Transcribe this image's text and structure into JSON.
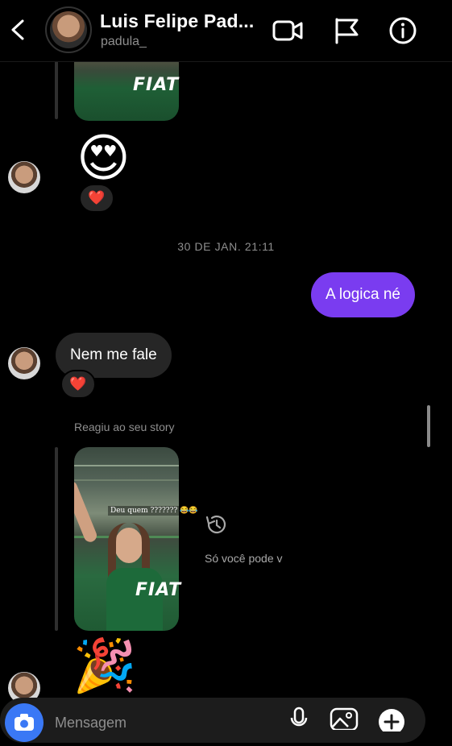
{
  "header": {
    "name": "Luis Felipe Pad...",
    "username": "padula_",
    "icons": [
      "back-icon",
      "video-call-icon",
      "flag-icon",
      "info-icon"
    ]
  },
  "thread": {
    "reaction_emoji": "❤️",
    "big_emoji_1": "😍",
    "timestamp": "30 DE JAN. 21:11",
    "sent_message": "A logica né",
    "received_message": "Nem me fale",
    "reacted_story_label": "Reagiu ao seu story",
    "story_caption": "Deu quem ??????? 😂😂",
    "story_jersey_text": "FIAT",
    "expired_story_text": "Só você pode v",
    "big_emoji_2": "🎉"
  },
  "composer": {
    "placeholder": "Mensagem",
    "icons": [
      "camera-icon",
      "microphone-icon",
      "gallery-icon",
      "plus-icon"
    ]
  },
  "colors": {
    "sent_bubble": "#7a3cf0",
    "received_bubble": "#262626",
    "camera_button": "#3a78f5",
    "heart": "#ff3040"
  }
}
